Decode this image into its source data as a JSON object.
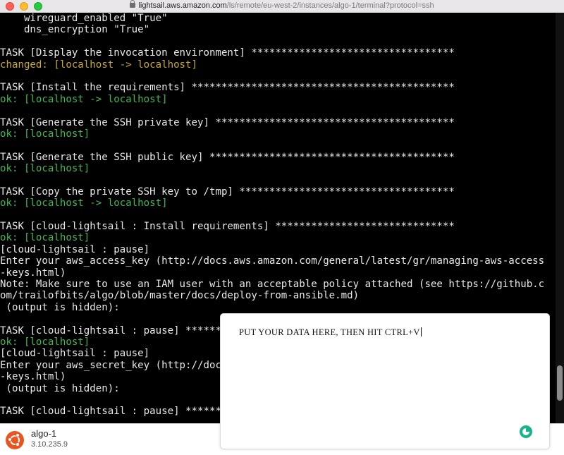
{
  "browser": {
    "url_host": "lightsail.aws.amazon.com",
    "url_path": "/ls/remote/eu-west-2/instances/algo-1/terminal?protocol=ssh"
  },
  "terminal": {
    "lines": [
      {
        "text": "    wireguard_enabled \"True\"",
        "kind": "normal"
      },
      {
        "text": "    dns_encryption \"True\"",
        "kind": "normal"
      },
      {
        "text": "",
        "kind": "normal"
      },
      {
        "text": "TASK [Display the invocation environment] **********************************",
        "kind": "normal"
      },
      {
        "text": "changed: [localhost -> localhost]",
        "kind": "changed"
      },
      {
        "text": "",
        "kind": "normal"
      },
      {
        "text": "TASK [Install the requirements] ********************************************",
        "kind": "normal"
      },
      {
        "text": "ok: [localhost -> localhost]",
        "kind": "ok"
      },
      {
        "text": "",
        "kind": "normal"
      },
      {
        "text": "TASK [Generate the SSH private key] ****************************************",
        "kind": "normal"
      },
      {
        "text": "ok: [localhost]",
        "kind": "ok"
      },
      {
        "text": "",
        "kind": "normal"
      },
      {
        "text": "TASK [Generate the SSH public key] *****************************************",
        "kind": "normal"
      },
      {
        "text": "ok: [localhost]",
        "kind": "ok"
      },
      {
        "text": "",
        "kind": "normal"
      },
      {
        "text": "TASK [Copy the private SSH key to /tmp] ************************************",
        "kind": "normal"
      },
      {
        "text": "ok: [localhost -> localhost]",
        "kind": "ok"
      },
      {
        "text": "",
        "kind": "normal"
      },
      {
        "text": "TASK [cloud-lightsail : Install requirements] ******************************",
        "kind": "normal"
      },
      {
        "text": "ok: [localhost]",
        "kind": "ok"
      },
      {
        "text": "[cloud-lightsail : pause]",
        "kind": "normal"
      },
      {
        "text": "Enter your aws_access_key (http://docs.aws.amazon.com/general/latest/gr/managing-aws-access",
        "kind": "normal"
      },
      {
        "text": "-keys.html)",
        "kind": "normal"
      },
      {
        "text": "Note: Make sure to use an IAM user with an acceptable policy attached (see https://github.c",
        "kind": "normal"
      },
      {
        "text": "om/trailofbits/algo/blob/master/docs/deploy-from-ansible.md)",
        "kind": "normal"
      },
      {
        "text": " (output is hidden):",
        "kind": "normal"
      },
      {
        "text": "",
        "kind": "normal"
      },
      {
        "text": "TASK [cloud-lightsail : pause] ******",
        "kind": "normal"
      },
      {
        "text": "ok: [localhost]",
        "kind": "ok"
      },
      {
        "text": "[cloud-lightsail : pause]",
        "kind": "normal"
      },
      {
        "text": "Enter your aws_secret_key (http://doc",
        "kind": "normal"
      },
      {
        "text": "-keys.html)",
        "kind": "normal"
      },
      {
        "text": " (output is hidden):",
        "kind": "normal"
      },
      {
        "text": "",
        "kind": "normal"
      },
      {
        "text": "TASK [cloud-lightsail : pause] ******",
        "kind": "normal"
      }
    ]
  },
  "instance": {
    "name": "algo-1",
    "ip": "3.10.235.9",
    "icon": "ubuntu-icon"
  },
  "paste_panel": {
    "prompt": "PUT YOUR DATA HERE, THEN HIT CTRL+V",
    "spinner_icon": "loading-spinner-icon"
  },
  "colors": {
    "ok": "#3fb950",
    "changed": "#c8a82f",
    "ubuntu": "#e95420",
    "spinner": "#19b38b"
  }
}
